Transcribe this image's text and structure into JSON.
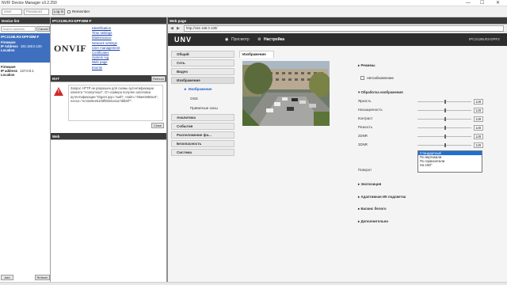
{
  "window": {
    "title": "NVIF Device Manager v3.2.250",
    "controls": [
      "—",
      "☐",
      "✕"
    ]
  },
  "login": {
    "user_placeholder": "User",
    "password_placeholder": "Password",
    "login_label": "Log in",
    "remember_label": "Remember"
  },
  "left": {
    "header": "Device list",
    "filter_placeholder": "Search address",
    "cancel_label": "Cancel",
    "device_name": "IPC2128LR3-DPF28M-F",
    "rows": [
      {
        "k": "Firmware",
        "v": ""
      },
      {
        "k": "IP Address",
        "v": "192.168.0.100"
      },
      {
        "k": "Location",
        "v": ""
      },
      {
        "k": "Firmware",
        "v": ""
      },
      {
        "k": "IP address",
        "v": "127.0.0.1"
      },
      {
        "k": "Location",
        "v": ""
      }
    ],
    "refresh_label": "Refresh",
    "add_label": "Add"
  },
  "mid": {
    "device_header": "IPC2128LR3-DPF28M-F",
    "logo": "ONVIF",
    "links": [
      "Identification",
      "Time settings",
      "Maintenance",
      "Network settings",
      "User management",
      "Certificates",
      "System log",
      "Web page",
      "Events"
    ],
    "nvt_header": "NVT",
    "refresh_label": "Refresh",
    "message": "Запрос HTTP не разрешен для схемы аутентификации клиента \"Anonymous\". От сервера получен заголовок аутентификации \"Digest qop=\"auth\", realm=\"49ae0e88ac6\", nonce=\"ec32e8ee5108f5932a41a7d5b5f\"\".",
    "close_label": "Close",
    "bottom_header": "Web"
  },
  "web": {
    "header": "Web page",
    "back": "◀",
    "forward": "▶",
    "url": "http://192.168.0.100/",
    "brand": "UNV",
    "tabs": [
      "Просмотр",
      "Настройка"
    ],
    "model": "IPC2128LR3-DPF2",
    "nav": [
      "Общий",
      "Сеть",
      "Видео",
      "Изображение",
      "Аналитика",
      "События",
      "Расположение фа...",
      "Безопасность",
      "Система"
    ],
    "subnav": [
      "Изображение",
      "OSD",
      "Приватные зоны"
    ],
    "content_tab": "Изображение",
    "sections": {
      "modes": "Режимы",
      "autorefresh": "Автообновление",
      "processing": "Обработка изображения",
      "exposure": "Экспозиция",
      "ir": "Адаптивная ИК подсветка",
      "wb": "Баланс белого",
      "extra": "Дополнительно"
    },
    "sliders": [
      {
        "label": "Яркость",
        "value": "128",
        "pos": 0.5
      },
      {
        "label": "Насыщенность",
        "value": "128",
        "pos": 0.5
      },
      {
        "label": "Контраст",
        "value": "128",
        "pos": 0.5
      },
      {
        "label": "Резкость",
        "value": "128",
        "pos": 0.5
      },
      {
        "label": "2DNR",
        "value": "128",
        "pos": 0.5
      },
      {
        "label": "3DNR",
        "value": "128",
        "pos": 0.5
      }
    ],
    "rotation_label": "Поворот",
    "rotation_options": [
      "Стандартный",
      "По вертикали",
      "По горизонтали",
      "На 180°"
    ],
    "rotation_selected": "Стандартный"
  }
}
